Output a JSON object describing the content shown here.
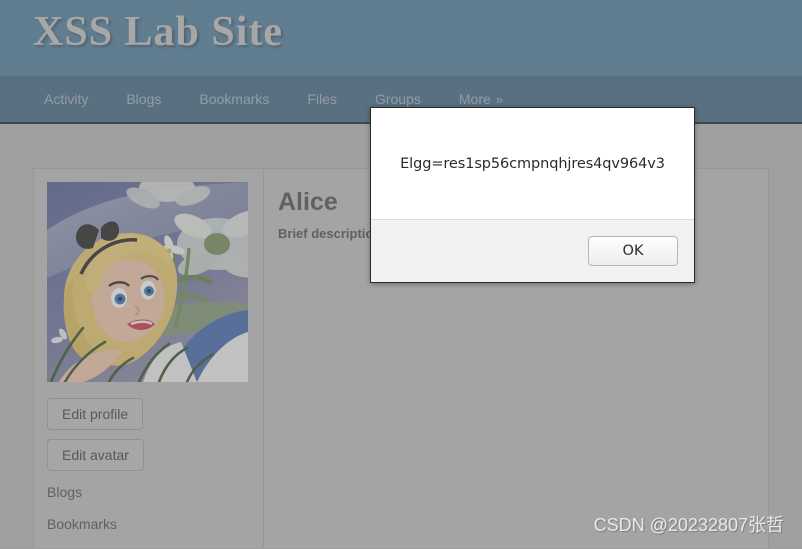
{
  "site": {
    "title": "XSS Lab Site",
    "header_color": "#4a7a9b",
    "nav_color": "#3d6480",
    "page_background": "#b7b7b7"
  },
  "nav": {
    "items": [
      {
        "label": "Activity"
      },
      {
        "label": "Blogs"
      },
      {
        "label": "Bookmarks"
      },
      {
        "label": "Files"
      },
      {
        "label": "Groups"
      },
      {
        "label": "More",
        "chevron": "»"
      }
    ]
  },
  "profile": {
    "name": "Alice",
    "brief_label": "Brief description",
    "avatar_alt": "alice-avatar",
    "buttons": [
      {
        "label": "Edit profile"
      },
      {
        "label": "Edit avatar"
      }
    ],
    "links": [
      {
        "label": "Blogs"
      },
      {
        "label": "Bookmarks"
      }
    ]
  },
  "dialog": {
    "message": "Elgg=res1sp56cmpnqhjres4qv964v3",
    "ok_label": "OK"
  },
  "watermark": {
    "text": "CSDN @20232807张哲"
  }
}
